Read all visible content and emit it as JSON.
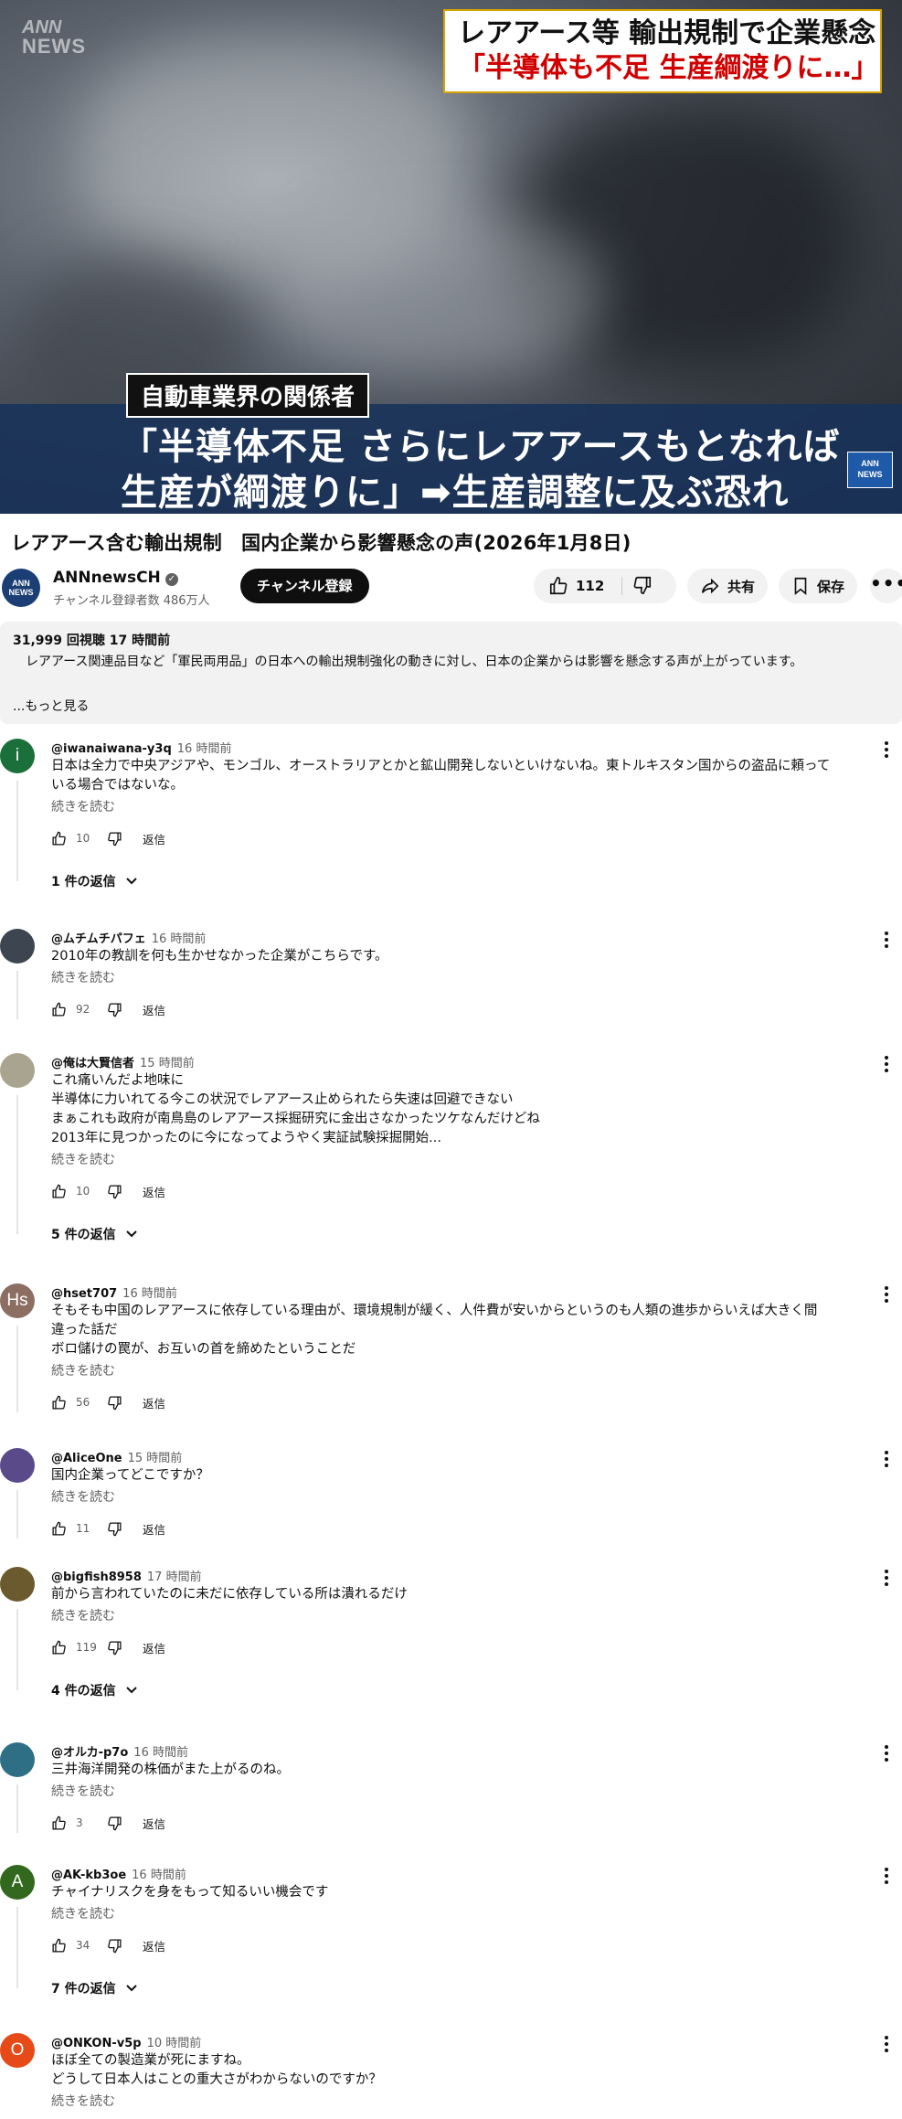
{
  "player": {
    "watermark_top": "ANN",
    "watermark_bottom": "NEWS",
    "headline_line1": "レアアース等 輸出規制で企業懸念",
    "headline_line2": "「半導体も不足 生産綱渡りに…」",
    "speaker": "自動車業界の関係者",
    "caption_line1": "「半導体不足 さらにレアアースもとなれば",
    "caption_line2": "生産が綱渡りに」➡生産調整に及ぶ恐れ",
    "logo_top": "ANN",
    "logo_bottom": "NEWS"
  },
  "video": {
    "title": "レアアース含む輸出規制　国内企業から影響懸念の声(2026年1月8日)",
    "channel_name": "ANNnewsCH",
    "channel_avatar_top": "ANN",
    "channel_avatar_bottom": "NEWS",
    "subscribers": "チャンネル登録者数 486万人",
    "subscribe_label": "チャンネル登録",
    "like_count": "112",
    "share_label": "共有",
    "save_label": "保存",
    "more_label": "•••"
  },
  "description": {
    "stats": "31,999 回視聴  17 時間前",
    "text": "　レアアース関連品目など「軍民両用品」の日本への輸出規制強化の動きに対し、日本の企業からは影響を懸念する声が上がっています。",
    "more": "...もっと見る"
  },
  "comments": [
    {
      "author": "@iwanaiwana-y3q",
      "time": "16 時間前",
      "avatar_letter": "i",
      "avatar_color": "#1b6f3a",
      "lines": [
        "日本は全力で中央アジアや、モンゴル、オーストラリアとかと鉱山開発しないといけないね。東トルキスタン国からの盗品に頼って",
        "いる場合ではないな。"
      ],
      "read_more": "続きを読む",
      "likes": "10",
      "reply_label": "返信",
      "replies": "1 件の返信"
    },
    {
      "author": "@ムチムチパフェ",
      "time": "16 時間前",
      "avatar_letter": "",
      "avatar_color": "#3d4650",
      "lines": [
        "2010年の教訓を何も生かせなかった企業がこちらです。"
      ],
      "read_more": "続きを読む",
      "likes": "92",
      "reply_label": "返信",
      "replies": ""
    },
    {
      "author": "@俺は大賢信者",
      "time": "15 時間前",
      "avatar_letter": "",
      "avatar_color": "#a9a48f",
      "lines": [
        "これ痛いんだよ地味に",
        "半導体に力いれてる今この状況でレアアース止められたら失速は回避できない",
        "まぁこれも政府が南鳥島のレアアース採掘研究に金出さなかったツケなんだけどね",
        "2013年に見つかったのに今になってようやく実証試験採掘開始..."
      ],
      "read_more": "続きを読む",
      "likes": "10",
      "reply_label": "返信",
      "replies": "5 件の返信"
    },
    {
      "author": "@hset707",
      "time": "16 時間前",
      "avatar_letter": "Hs",
      "avatar_color": "#8d6e63",
      "lines": [
        "そもそも中国のレアアースに依存している理由が、環境規制が緩く、人件費が安いからというのも人類の進歩からいえば大きく間",
        "違った話だ",
        "ボロ儲けの罠が、お互いの首を締めたということだ"
      ],
      "read_more": "続きを読む",
      "likes": "56",
      "reply_label": "返信",
      "replies": ""
    },
    {
      "author": "@AliceOne",
      "time": "15 時間前",
      "avatar_letter": "",
      "avatar_color": "#5a4a8a",
      "lines": [
        "国内企業ってどこですか？"
      ],
      "read_more": "続きを読む",
      "likes": "11",
      "reply_label": "返信",
      "replies": ""
    },
    {
      "author": "@bigfish8958",
      "time": "17 時間前",
      "avatar_letter": "",
      "avatar_color": "#6b5a2e",
      "lines": [
        "前から言われていたのに未だに依存している所は潰れるだけ"
      ],
      "read_more": "続きを読む",
      "likes": "119",
      "reply_label": "返信",
      "replies": "4 件の返信"
    },
    {
      "author": "@オルカ-p7o",
      "time": "16 時間前",
      "avatar_letter": "",
      "avatar_color": "#2f6f86",
      "lines": [
        "三井海洋開発の株価がまた上がるのね。"
      ],
      "read_more": "続きを読む",
      "likes": "3",
      "reply_label": "返信",
      "replies": ""
    },
    {
      "author": "@AK-kb3oe",
      "time": "16 時間前",
      "avatar_letter": "A",
      "avatar_color": "#33691e",
      "lines": [
        "チャイナリスクを身をもって知るいい機会です"
      ],
      "read_more": "続きを読む",
      "likes": "34",
      "reply_label": "返信",
      "replies": "7 件の返信"
    },
    {
      "author": "@ONKON-v5p",
      "time": "10 時間前",
      "avatar_letter": "O",
      "avatar_color": "#e64a19",
      "lines": [
        "ほぼ全ての製造業が死にますね。",
        "どうして日本人はことの重大さがわからないのですか？"
      ],
      "read_more": "続きを読む",
      "likes": "",
      "reply_label": "",
      "replies": ""
    }
  ]
}
